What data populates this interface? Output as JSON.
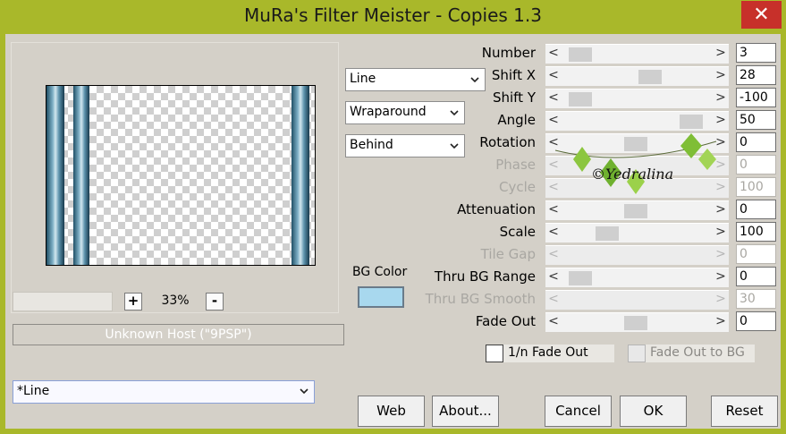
{
  "window": {
    "title": "MuRa's Filter Meister - Copies 1.3",
    "accent_color": "#a9b82a",
    "close_color": "#c7302a"
  },
  "preview": {
    "zoom_level": "33%",
    "zoom_in": "+",
    "zoom_out": "-",
    "host_text": "Unknown Host (\"9PSP\")"
  },
  "combos": {
    "mode": "Line",
    "edge": "Wraparound",
    "order": "Behind"
  },
  "bg": {
    "label": "BG Color",
    "color": "#a8d8ee"
  },
  "params": [
    {
      "label": "Number",
      "value": "3",
      "enabled": true
    },
    {
      "label": "Shift X",
      "value": "28",
      "enabled": true
    },
    {
      "label": "Shift Y",
      "value": "-100",
      "enabled": true
    },
    {
      "label": "Angle",
      "value": "50",
      "enabled": true
    },
    {
      "label": "Rotation",
      "value": "0",
      "enabled": true
    },
    {
      "label": "Phase",
      "value": "0",
      "enabled": false
    },
    {
      "label": "Cycle",
      "value": "100",
      "enabled": false
    },
    {
      "label": "Attenuation",
      "value": "0",
      "enabled": true
    },
    {
      "label": "Scale",
      "value": "100",
      "enabled": true
    },
    {
      "label": "Tile Gap",
      "value": "0",
      "enabled": false
    },
    {
      "label": "Thru BG Range",
      "value": "0",
      "enabled": true
    },
    {
      "label": "Thru BG Smooth",
      "value": "30",
      "enabled": false
    },
    {
      "label": "Fade Out",
      "value": "0",
      "enabled": true
    }
  ],
  "slider_arrows": {
    "left": "<",
    "right": ">"
  },
  "checkboxes": {
    "fade_1n": "1/n Fade Out",
    "fade_bg": "Fade Out to BG"
  },
  "preset": "*Line",
  "watermark": "©Yedralina",
  "buttons": {
    "web": "Web",
    "about": "About...",
    "cancel": "Cancel",
    "ok": "OK",
    "reset": "Reset"
  }
}
